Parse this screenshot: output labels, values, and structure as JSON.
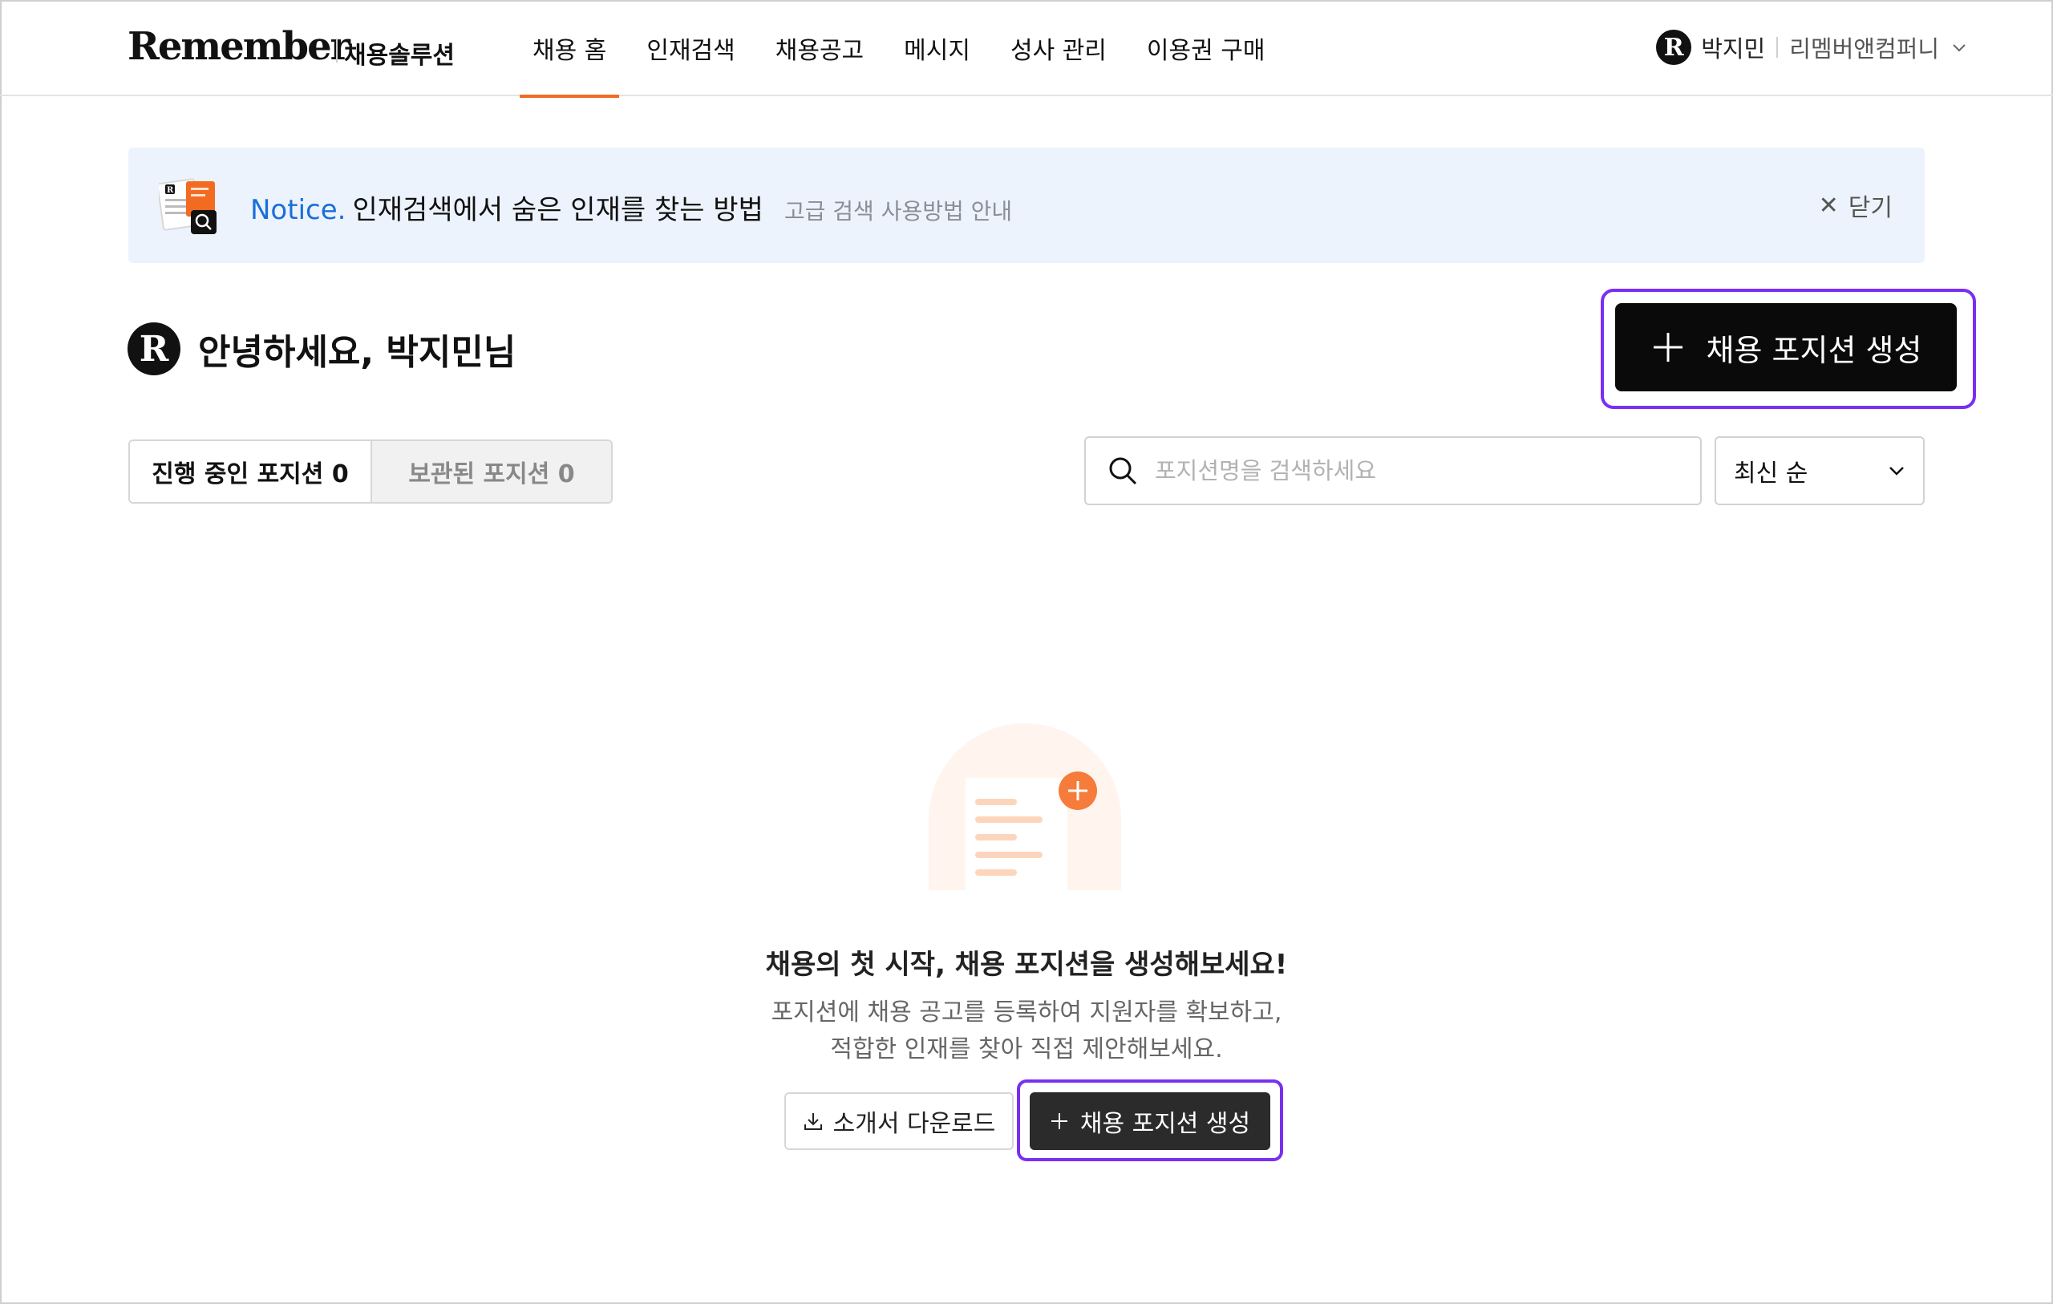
{
  "header": {
    "logo": "Remember",
    "logo_sub": "채용솔루션",
    "nav": [
      "채용 홈",
      "인재검색",
      "채용공고",
      "메시지",
      "성사 관리",
      "이용권 구매"
    ],
    "active_nav": "채용 홈",
    "user_initial": "R",
    "user_name": "박지민",
    "company": "리멤버앤컴퍼니"
  },
  "notice": {
    "label": "Notice.",
    "message": "인재검색에서 숨은 인재를 찾는 방법",
    "sub": "고급 검색 사용방법 안내",
    "close_label": "닫기"
  },
  "greeting": {
    "initial": "R",
    "text": "안녕하세요, 박지민님"
  },
  "create_button": {
    "label": "채용 포지션 생성"
  },
  "tabs": {
    "active": "진행 중인 포지션 0",
    "archived": "보관된 포지션 0"
  },
  "search": {
    "placeholder": "포지션명을 검색하세요",
    "value": ""
  },
  "sort": {
    "selected": "최신 순"
  },
  "empty_state": {
    "title": "채용의 첫 시작, 채용 포지션을 생성해보세요!",
    "desc_line1": "포지션에 채용 공고를 등록하여 지원자를 확보하고,",
    "desc_line2": "적합한 인재를 찾아 직접 제안해보세요.",
    "download_label": "소개서 다운로드",
    "create_label": "채용 포지션 생성"
  },
  "colors": {
    "accent": "#f26b21",
    "notice_bg": "#edf3fc",
    "notice_label": "#1a6fd8",
    "highlight": "#7a2ff0"
  }
}
